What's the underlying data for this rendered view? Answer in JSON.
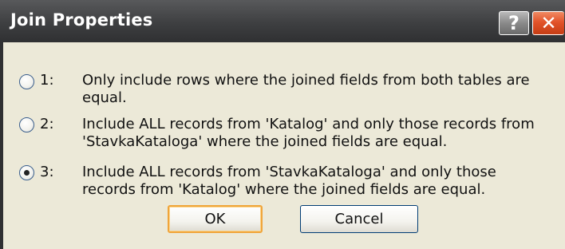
{
  "window": {
    "title": "Join Properties",
    "help_glyph": "?",
    "close_glyph": "✕"
  },
  "options": [
    {
      "number": "1:",
      "line1": "Only include rows where the joined fields from both tables are",
      "line2": "equal.",
      "selected": false
    },
    {
      "number": "2:",
      "line1": "Include ALL records from 'Katalog' and only those records from",
      "line2": "'StavkaKataloga' where the joined fields are equal.",
      "selected": false
    },
    {
      "number": "3:",
      "line1": "Include ALL records from 'StavkaKataloga' and only those",
      "line2": "records from 'Katalog' where the joined fields are equal.",
      "selected": true
    }
  ],
  "buttons": {
    "ok_label": "OK",
    "cancel_label": "Cancel"
  },
  "colors": {
    "titlebar": "#3e3f41",
    "dialog_background": "#ece9d8",
    "close_button": "#e2532a",
    "default_button_border": "#f0a53a"
  }
}
